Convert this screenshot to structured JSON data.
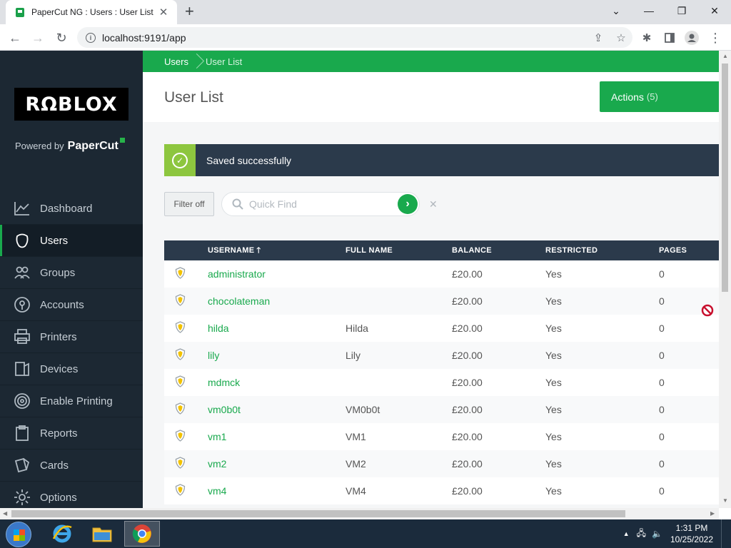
{
  "browser": {
    "tab_title": "PaperCut NG : Users : User List",
    "tab_close": "✕",
    "new_tab": "+",
    "url": "localhost:9191/app",
    "minimize": "—",
    "maximize": "❐",
    "close": "✕"
  },
  "sidebar": {
    "logo_text": "RΩBLOX",
    "powered_prefix": "Powered by",
    "powered_brand": "PaperCut",
    "items": [
      {
        "label": "Dashboard",
        "icon": "dashboard-icon"
      },
      {
        "label": "Users",
        "icon": "users-icon",
        "active": true
      },
      {
        "label": "Groups",
        "icon": "groups-icon"
      },
      {
        "label": "Accounts",
        "icon": "accounts-icon"
      },
      {
        "label": "Printers",
        "icon": "printer-icon"
      },
      {
        "label": "Devices",
        "icon": "devices-icon"
      },
      {
        "label": "Enable Printing",
        "icon": "enable-printing-icon"
      },
      {
        "label": "Reports",
        "icon": "reports-icon"
      },
      {
        "label": "Cards",
        "icon": "cards-icon"
      },
      {
        "label": "Options",
        "icon": "options-icon"
      }
    ]
  },
  "breadcrumb": {
    "root": "Users",
    "current": "User List"
  },
  "page": {
    "title": "User List",
    "actions_label": "Actions",
    "actions_count": "(5)"
  },
  "alert": {
    "message": "Saved successfully"
  },
  "filter": {
    "filter_label": "Filter off",
    "quickfind_placeholder": "Quick Find",
    "quickfind_value": "",
    "clear_label": "✕"
  },
  "table": {
    "columns": {
      "username": "USERNAME",
      "full_name": "FULL NAME",
      "balance": "BALANCE",
      "restricted": "RESTRICTED",
      "pages": "PAGES"
    },
    "sort_indicator": "🡑",
    "rows": [
      {
        "username": "administrator",
        "full_name": "",
        "balance": "£20.00",
        "restricted": "Yes",
        "pages": "0"
      },
      {
        "username": "chocolateman",
        "full_name": "",
        "balance": "£20.00",
        "restricted": "Yes",
        "pages": "0"
      },
      {
        "username": "hilda",
        "full_name": "Hilda",
        "balance": "£20.00",
        "restricted": "Yes",
        "pages": "0"
      },
      {
        "username": "lily",
        "full_name": "Lily",
        "balance": "£20.00",
        "restricted": "Yes",
        "pages": "0"
      },
      {
        "username": "mdmck",
        "full_name": "",
        "balance": "£20.00",
        "restricted": "Yes",
        "pages": "0"
      },
      {
        "username": "vm0b0t",
        "full_name": "VM0b0t",
        "balance": "£20.00",
        "restricted": "Yes",
        "pages": "0"
      },
      {
        "username": "vm1",
        "full_name": "VM1",
        "balance": "£20.00",
        "restricted": "Yes",
        "pages": "0"
      },
      {
        "username": "vm2",
        "full_name": "VM2",
        "balance": "£20.00",
        "restricted": "Yes",
        "pages": "0"
      },
      {
        "username": "vm4",
        "full_name": "VM4",
        "balance": "£20.00",
        "restricted": "Yes",
        "pages": "0"
      }
    ]
  },
  "taskbar": {
    "time": "1:31 PM",
    "date": "10/25/2022",
    "apps": [
      "internet-explorer-icon",
      "file-explorer-icon",
      "chrome-icon"
    ]
  },
  "colors": {
    "brand_green": "#19a94d",
    "sidebar_bg": "#1c2833",
    "header_dark": "#2b3a4b",
    "success_green": "#8dc63f"
  }
}
